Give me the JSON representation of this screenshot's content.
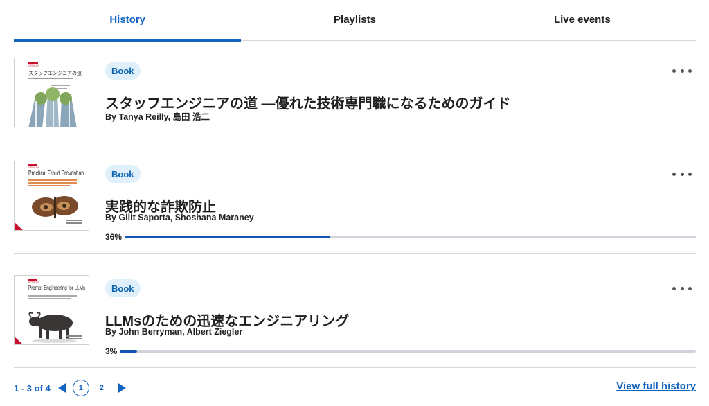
{
  "tabs": [
    {
      "label": "History",
      "active": true
    },
    {
      "label": "Playlists",
      "active": false
    },
    {
      "label": "Live events",
      "active": false
    }
  ],
  "items": [
    {
      "badge": "Book",
      "title": "スタッフエンジニアの道 ―優れた技術専門職になるためのガイド",
      "authors": "By Tanya Reilly, 島田 浩二",
      "cover": {
        "publisher": "O'REILLY",
        "title": "スタッフエンジニアの道"
      },
      "progress_label": "",
      "progress": null
    },
    {
      "badge": "Book",
      "title": "実践的な詐欺防止",
      "authors": "By Gilit Saporta, Shoshana Maraney",
      "cover": {
        "publisher": "O'REILLY",
        "title": "Practical Fraud Prevention"
      },
      "progress_label": "36%",
      "progress": 0.36
    },
    {
      "badge": "Book",
      "title": "LLMsのための迅速なエンジニアリング",
      "authors": "By John Berryman, Albert Ziegler",
      "cover": {
        "publisher": "O'REILLY",
        "title": "Prompt Engineering for LLMs"
      },
      "progress_label": "3%",
      "progress": 0.03
    }
  ],
  "pagination": {
    "range": "1 - 3 of 4",
    "pages": [
      "1",
      "2"
    ],
    "current": "1"
  },
  "view_full_history": "View full history",
  "colors": {
    "accent": "#1565c0",
    "badge_bg": "#dff0fb",
    "progress_fill": "#1155b0",
    "progress_track": "#d2d2dc",
    "divider": "#d6d6d6"
  },
  "icons": {
    "more": "more-horizontal-icon",
    "prev": "triangle-left-icon",
    "next": "triangle-right-icon"
  }
}
